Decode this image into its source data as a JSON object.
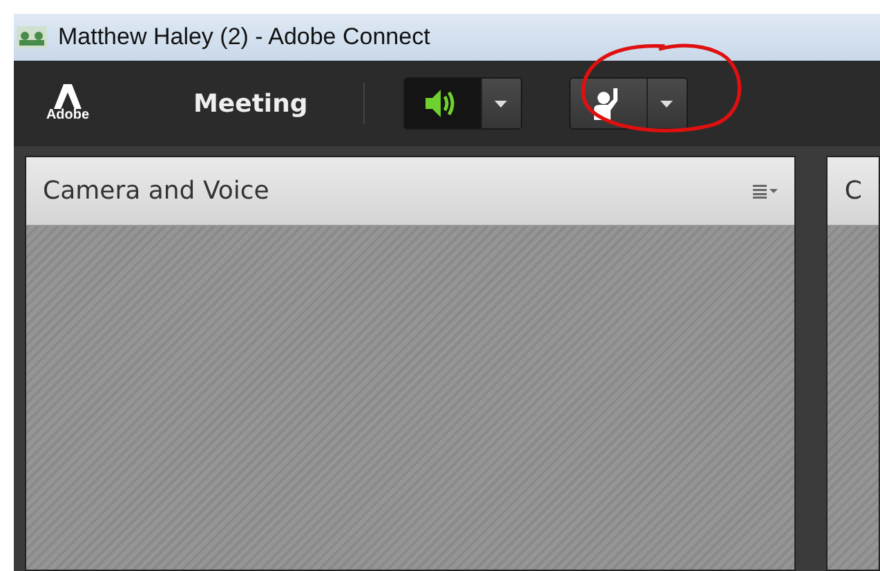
{
  "window": {
    "title": "Matthew Haley (2) - Adobe Connect"
  },
  "toolbar": {
    "logo_text": "Adobe",
    "menu": "Meeting",
    "speaker": {
      "on": true
    }
  },
  "pods": [
    {
      "title": "Camera and Voice",
      "menu": true
    },
    {
      "title": "C",
      "menu": false
    }
  ]
}
